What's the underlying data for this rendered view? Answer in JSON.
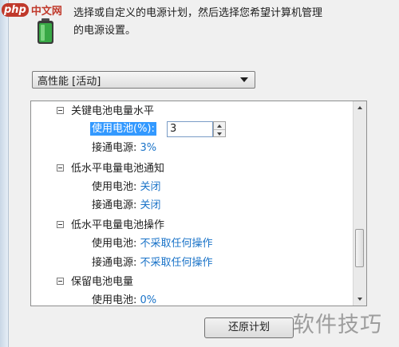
{
  "watermark": {
    "brand": "php",
    "suffix": "中文网",
    "corner_text": "软件技巧"
  },
  "header": {
    "description_line1": "选择或自定义的电源计划，然后选择您希望计算机管理",
    "description_line2": "的电源设置。"
  },
  "plan_select": {
    "value": "高性能 [活动]"
  },
  "tree": {
    "groups": [
      {
        "label": "关键电池电量水平",
        "on_battery_label": "使用电池(%):",
        "on_battery_value": "3",
        "plugged_label": "接通电源:",
        "plugged_value": "3%"
      },
      {
        "label": "低水平电量电池通知",
        "on_battery_label": "使用电池:",
        "on_battery_value": "关闭",
        "plugged_label": "接通电源:",
        "plugged_value": "关闭"
      },
      {
        "label": "低水平电量电池操作",
        "on_battery_label": "使用电池:",
        "on_battery_value": "不采取任何操作",
        "plugged_label": "接通电源:",
        "plugged_value": "不采取任何操作"
      },
      {
        "label": "保留电池电量",
        "on_battery_label": "使用电池:",
        "on_battery_value": "0%"
      }
    ]
  },
  "buttons": {
    "restore": "还原计划"
  },
  "colors": {
    "link": "#1a73c8",
    "selection": "#3399ff"
  }
}
